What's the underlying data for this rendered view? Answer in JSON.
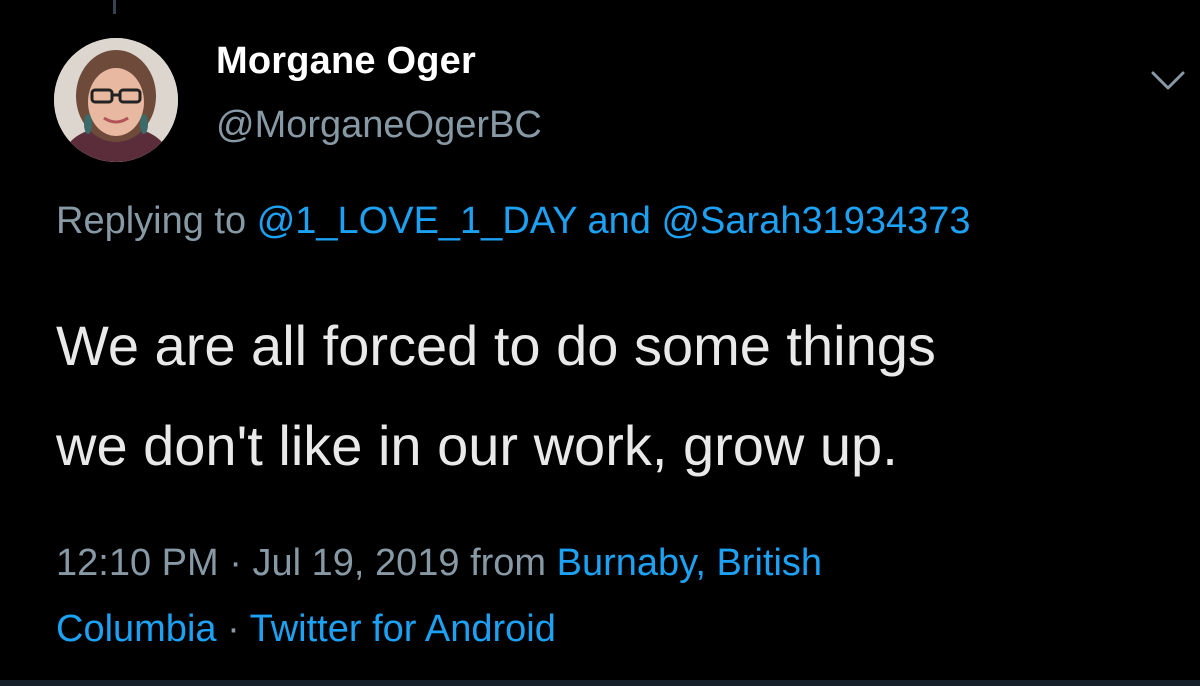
{
  "author": {
    "display_name": "Morgane Oger",
    "handle": "@MorganeOgerBC"
  },
  "reply": {
    "prefix": "Replying to",
    "mention_1": "@1_LOVE_1_DAY",
    "conjunction": "and",
    "mention_2": "@Sarah31934373"
  },
  "tweet": {
    "line_1": "We are all forced to do some things",
    "line_2": "we don't like in our work, grow up."
  },
  "meta": {
    "time": "12:10 PM",
    "separator": "·",
    "date": "Jul 19, 2019",
    "from_label": "from",
    "location_part_1": "Burnaby, British",
    "location_part_2": "Columbia",
    "client": "Twitter for Android"
  },
  "icons": {
    "menu": "chevron-down-icon",
    "avatar": "avatar"
  },
  "colors": {
    "background": "#000000",
    "link": "#1da1f2",
    "secondary_text": "#8899a6",
    "primary_text": "#ffffff"
  }
}
